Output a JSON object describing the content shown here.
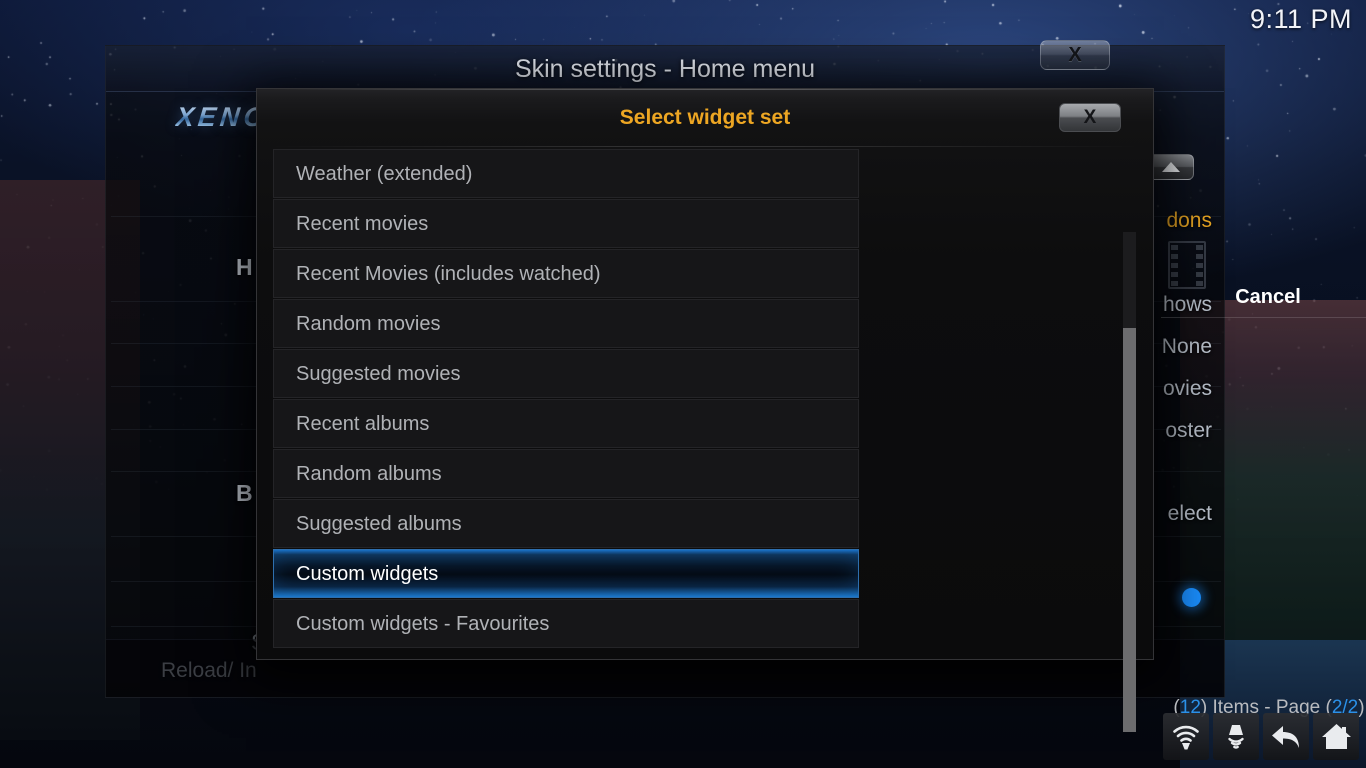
{
  "clock": {
    "time": "9:11 PM"
  },
  "background_window": {
    "title": "Skin settings - Home menu",
    "logo": "XENON",
    "close_label": "X",
    "up_arrow_icon": "chevron-up-icon",
    "left_labels": [
      {
        "text": "H",
        "dim": false
      },
      {
        "text": "B",
        "dim": false
      },
      {
        "text": "S",
        "dim": true
      },
      {
        "text": "Reload/ In",
        "dim": true
      }
    ],
    "right_values": [
      {
        "text": "dons",
        "accent": true
      },
      {
        "text": "hows",
        "accent": false
      },
      {
        "text": "None",
        "accent": false
      },
      {
        "text": "ovies",
        "accent": false
      },
      {
        "text": "oster",
        "accent": false
      },
      {
        "text": "elect",
        "accent": false
      }
    ],
    "filmstrip_icon": "film-strip-icon",
    "indicator_icon": "blue-dot-indicator"
  },
  "dialog": {
    "title": "Select widget set",
    "close_label": "X",
    "cancel_label": "Cancel",
    "pager": {
      "item_count": "12",
      "items_label": "Items - Page",
      "page": "2/2",
      "open_paren": "(",
      "close_paren": ")"
    },
    "items": [
      {
        "label": "Weather (extended)",
        "selected": false
      },
      {
        "label": "Recent movies",
        "selected": false
      },
      {
        "label": "Recent Movies (includes watched)",
        "selected": false
      },
      {
        "label": "Random movies",
        "selected": false
      },
      {
        "label": "Suggested movies",
        "selected": false
      },
      {
        "label": "Recent albums",
        "selected": false
      },
      {
        "label": "Random albums",
        "selected": false
      },
      {
        "label": "Suggested albums",
        "selected": false
      },
      {
        "label": "Custom widgets",
        "selected": true
      },
      {
        "label": "Custom widgets - Favourites",
        "selected": false
      }
    ]
  },
  "taskbar": {
    "buttons": [
      {
        "icon": "wifi-signal-icon"
      },
      {
        "icon": "speaker-volume-icon"
      },
      {
        "icon": "back-arrow-icon"
      },
      {
        "icon": "home-icon"
      }
    ]
  },
  "colors": {
    "dialog_title": "#eda623",
    "accent_blue": "#2b90e8",
    "selection_blue": "#1b75ce"
  }
}
